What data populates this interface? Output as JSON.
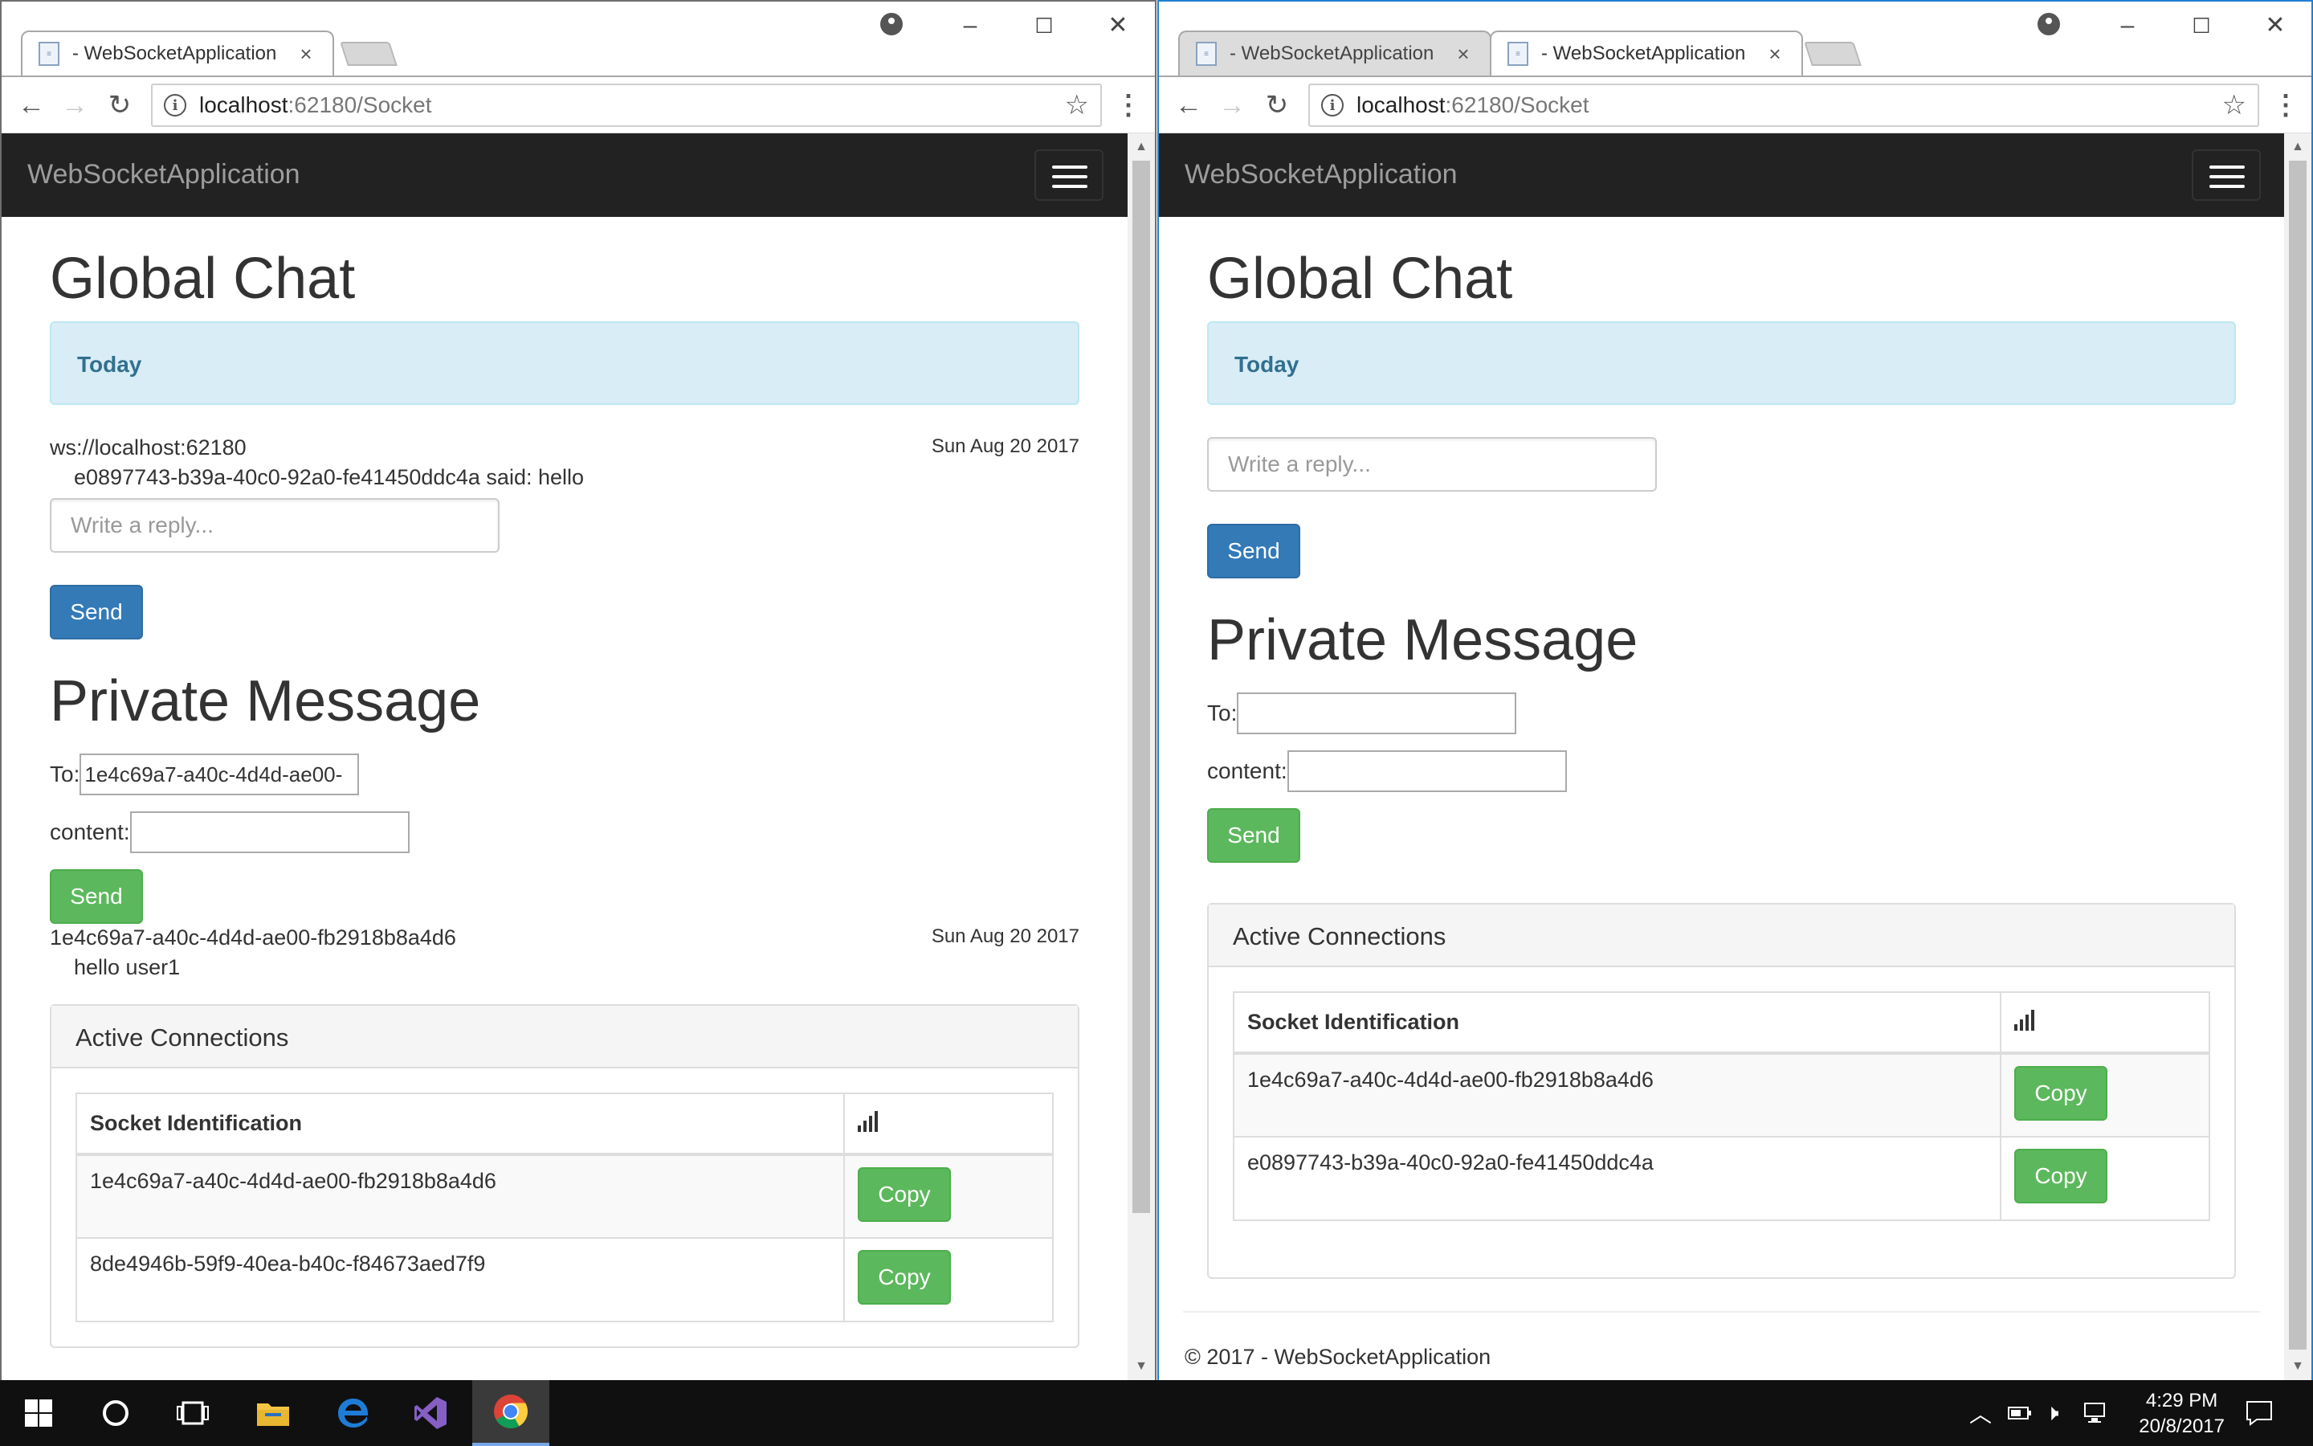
{
  "left_window": {
    "tabs": [
      {
        "label": "- WebSocketApplication",
        "close": "×"
      }
    ],
    "url": {
      "host": "localhost",
      "rest": ":62180/Socket"
    },
    "navbar": {
      "brand": "WebSocketApplication"
    },
    "global_chat": {
      "title": "Global Chat",
      "date_banner": "Today",
      "message": {
        "sender": "ws://localhost:62180",
        "date": "Sun Aug 20 2017",
        "body": "e0897743-b39a-40c0-92a0-fe41450ddc4a said: hello"
      },
      "reply_placeholder": "Write a reply...",
      "send_label": "Send"
    },
    "private_message": {
      "title": "Private Message",
      "to_label": "To:",
      "to_value": "1e4c69a7-a40c-4d4d-ae00-",
      "content_label": "content:",
      "content_value": "",
      "send_label": "Send",
      "message": {
        "sender": "1e4c69a7-a40c-4d4d-ae00-fb2918b8a4d6",
        "date": "Sun Aug 20 2017",
        "body": "hello user1"
      }
    },
    "active_connections": {
      "title": "Active Connections",
      "columns": [
        "Socket Identification"
      ],
      "rows": [
        {
          "id": "1e4c69a7-a40c-4d4d-ae00-fb2918b8a4d6",
          "action": "Copy"
        },
        {
          "id": "8de4946b-59f9-40ea-b40c-f84673aed7f9",
          "action": "Copy"
        }
      ]
    }
  },
  "right_window": {
    "tabs": [
      {
        "label": "- WebSocketApplication",
        "close": "×"
      },
      {
        "label": "- WebSocketApplication",
        "close": "×"
      }
    ],
    "url": {
      "host": "localhost",
      "rest": ":62180/Socket"
    },
    "navbar": {
      "brand": "WebSocketApplication"
    },
    "global_chat": {
      "title": "Global Chat",
      "date_banner": "Today",
      "reply_placeholder": "Write a reply...",
      "send_label": "Send"
    },
    "private_message": {
      "title": "Private Message",
      "to_label": "To:",
      "to_value": "",
      "content_label": "content:",
      "content_value": "",
      "send_label": "Send"
    },
    "active_connections": {
      "title": "Active Connections",
      "columns": [
        "Socket Identification"
      ],
      "rows": [
        {
          "id": "1e4c69a7-a40c-4d4d-ae00-fb2918b8a4d6",
          "action": "Copy"
        },
        {
          "id": "e0897743-b39a-40c0-92a0-fe41450ddc4a",
          "action": "Copy"
        }
      ]
    },
    "footer": "© 2017 - WebSocketApplication"
  },
  "taskbar": {
    "apps": [
      "start-icon",
      "cortana-icon",
      "task-view-icon",
      "file-explorer-icon",
      "edge-icon",
      "visual-studio-icon",
      "chrome-icon"
    ],
    "clock": {
      "time": "4:29 PM",
      "date": "20/8/2017"
    }
  },
  "colors": {
    "navbar": "#222222",
    "primary": "#337ab7",
    "success": "#5cb85c",
    "info_bg": "#d9edf7",
    "info_text": "#31708f",
    "active_window_border": "#1f7fd3"
  }
}
